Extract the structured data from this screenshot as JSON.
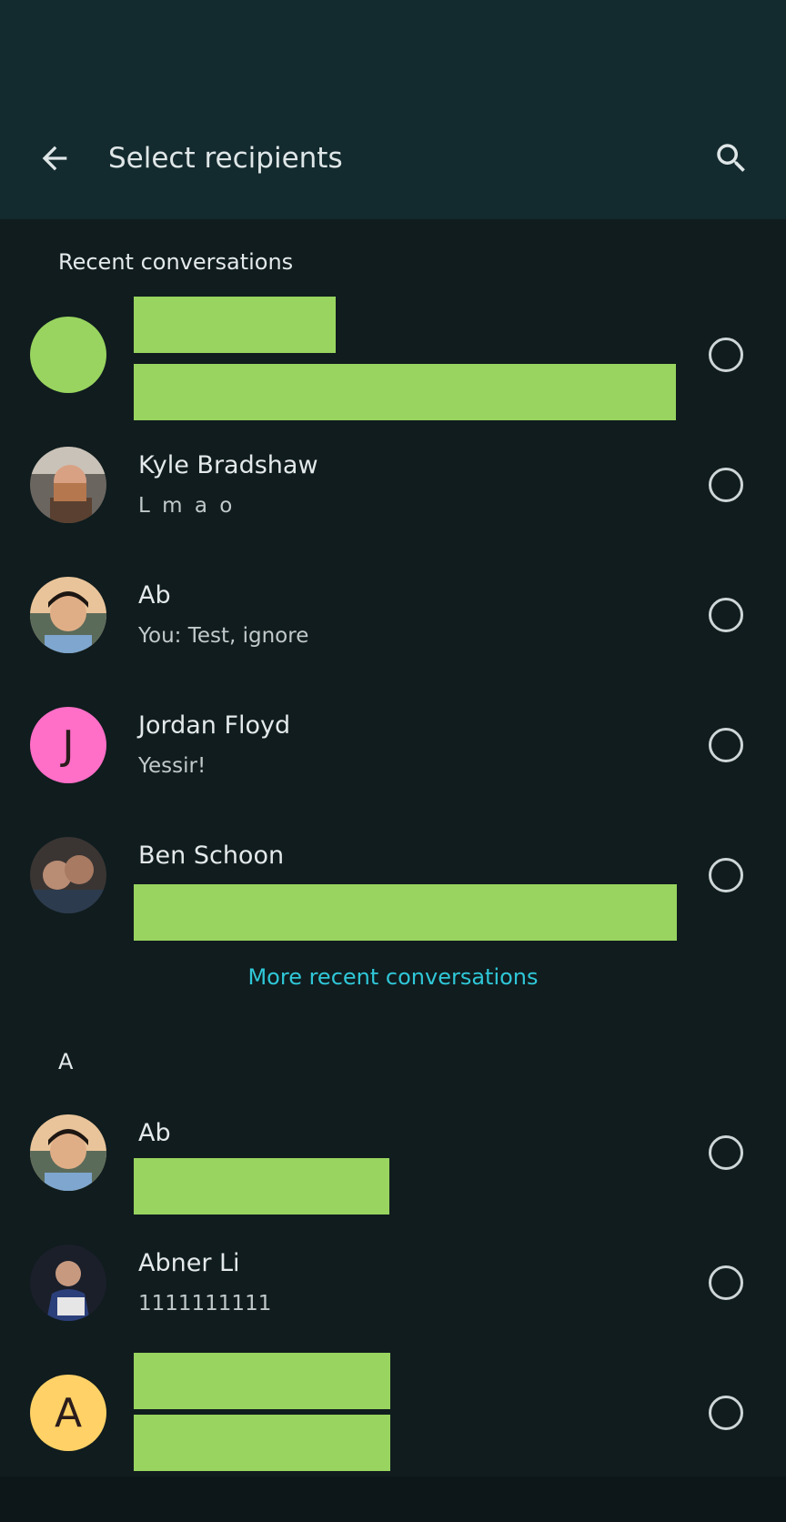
{
  "header": {
    "title": "Select recipients",
    "back_icon": "arrow-back-icon",
    "search_icon": "search-icon"
  },
  "sections": {
    "recent_label": "Recent conversations",
    "more_link": "More recent conversations",
    "alpha_label": "A"
  },
  "recent": [
    {
      "name": "",
      "subtitle": ""
    },
    {
      "name": "Kyle Bradshaw",
      "subtitle": "L m a o"
    },
    {
      "name": "Ab",
      "subtitle": "You: Test, ignore"
    },
    {
      "name": "Jordan Floyd",
      "subtitle": "Yessir!",
      "initial": "J"
    },
    {
      "name": "Ben Schoon",
      "subtitle": ""
    }
  ],
  "contacts": [
    {
      "name": "Ab",
      "subtitle": ""
    },
    {
      "name": "Abner Li",
      "subtitle": "1111111111"
    },
    {
      "name": "",
      "subtitle": "",
      "initial": "A"
    }
  ],
  "colors": {
    "appbar": "#132a2e",
    "background": "#101c1e",
    "accent_link": "#2fc7d8",
    "redaction": "#98d45f",
    "avatar_pink": "#ff6ec7",
    "avatar_yellow": "#ffd166"
  }
}
